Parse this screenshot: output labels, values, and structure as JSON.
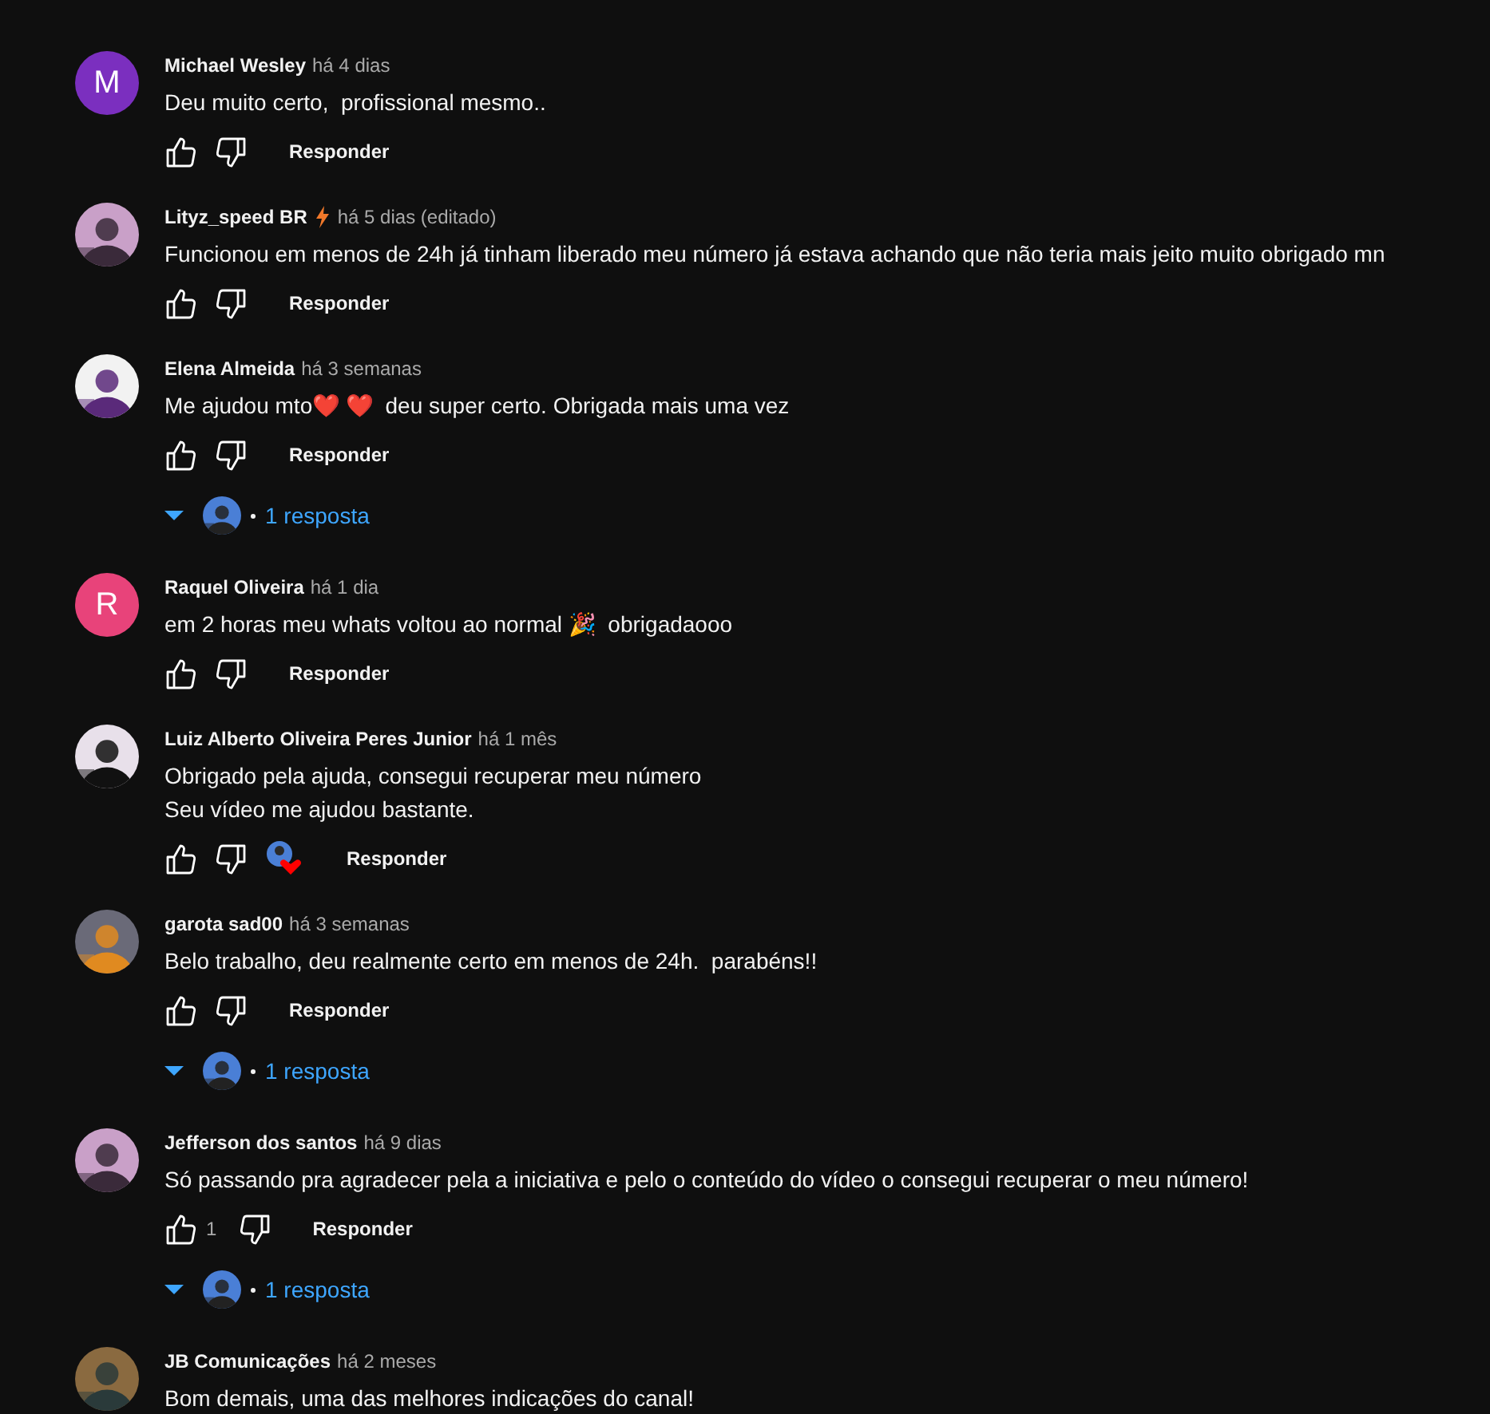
{
  "comments": [
    {
      "author": "Michael Wesley",
      "time": "há 4 dias",
      "badge": false,
      "avatar": {
        "kind": "letter",
        "letter": "M",
        "color": "#7b2fbf"
      },
      "text": [
        "Deu muito certo,  profissional mesmo.."
      ],
      "hearted": false,
      "reply_label": "Responder"
    },
    {
      "author": "Lityz_speed BR",
      "time": "há 5 dias (editado)",
      "badge": true,
      "avatar": {
        "kind": "picture"
      },
      "text": [
        "Funcionou em menos de 24h já tinham liberado meu número já estava achando que não teria mais jeito muito obrigado mn"
      ],
      "hearted": false,
      "reply_label": "Responder"
    },
    {
      "author": "Elena Almeida",
      "time": "há 3 semanas",
      "badge": false,
      "avatar": {
        "kind": "picture"
      },
      "text": [
        "Me ajudou mto❤️ ❤️  deu super certo. Obrigada mais uma vez"
      ],
      "hearted": false,
      "reply_label": "Responder",
      "replies": {
        "label": "1 resposta",
        "expanded": false
      }
    },
    {
      "author": "Raquel Oliveira",
      "time": "há 1 dia",
      "badge": false,
      "avatar": {
        "kind": "letter",
        "letter": "R",
        "color": "#e8437a"
      },
      "text": [
        "em 2 horas meu whats voltou ao normal 🎉  obrigadaooo"
      ],
      "hearted": false,
      "reply_label": "Responder"
    },
    {
      "author": "Luiz Alberto Oliveira Peres Junior",
      "time": "há 1 mês",
      "badge": false,
      "avatar": {
        "kind": "picture"
      },
      "text": [
        "Obrigado pela ajuda, consegui recuperar meu número",
        "Seu vídeo me ajudou bastante."
      ],
      "hearted": true,
      "reply_label": "Responder"
    },
    {
      "author": "garota sad00",
      "time": "há 3 semanas",
      "badge": false,
      "avatar": {
        "kind": "picture"
      },
      "text": [
        "Belo trabalho, deu realmente certo em menos de 24h.  parabéns!!"
      ],
      "hearted": false,
      "reply_label": "Responder",
      "replies": {
        "label": "1 resposta",
        "expanded": false
      }
    },
    {
      "author": "Jefferson dos santos",
      "time": "há 9 dias",
      "badge": false,
      "avatar": {
        "kind": "picture"
      },
      "text": [
        "Só passando pra agradecer pela a iniciativa e pelo o conteúdo do vídeo o consegui recuperar o meu número!"
      ],
      "likes": "1",
      "hearted": false,
      "reply_label": "Responder",
      "replies": {
        "label": "1 resposta",
        "expanded": false
      }
    },
    {
      "author": "JB Comunicações",
      "time": "há 2 meses",
      "badge": false,
      "avatar": {
        "kind": "picture"
      },
      "text": [
        "Bom demais, uma das melhores indicações do canal!"
      ]
    }
  ]
}
